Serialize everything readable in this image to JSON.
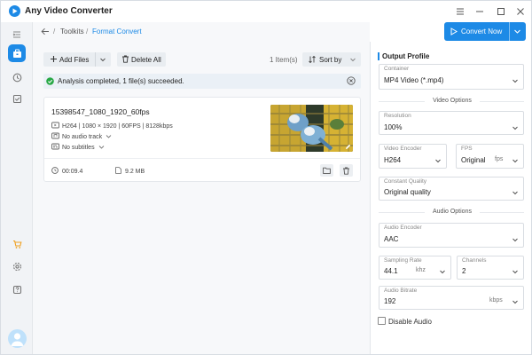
{
  "app": {
    "title": "Any Video Converter"
  },
  "breadcrumb": {
    "toolkits": "Toolkits",
    "separator": "/",
    "current": "Format Convert"
  },
  "toolbar": {
    "add_files": "Add Files",
    "delete_all": "Delete All",
    "item_count": "1 Item(s)",
    "sort_by": "Sort by",
    "convert_now": "Convert Now"
  },
  "banner": {
    "text": "Analysis completed, 1 file(s) succeeded."
  },
  "file": {
    "name": "15398547_1080_1920_60fps",
    "video_info": "H264 | 1080 × 1920 | 60FPS | 8128kbps",
    "audio": "No audio track",
    "subtitles": "No subtitles",
    "duration": "00:09.4",
    "size": "9.2 MB"
  },
  "output_profile": {
    "title": "Output Profile",
    "container": {
      "label": "Container",
      "value": "MP4 Video (*.mp4)"
    },
    "video_section": "Video Options",
    "resolution": {
      "label": "Resolution",
      "value": "100%"
    },
    "video_encoder": {
      "label": "Video Encoder",
      "value": "H264"
    },
    "fps": {
      "label": "FPS",
      "value": "Original",
      "unit": "fps"
    },
    "quality": {
      "label": "Constant Quality",
      "value": "Original quality"
    },
    "audio_section": "Audio Options",
    "audio_encoder": {
      "label": "Audio Encoder",
      "value": "AAC"
    },
    "sampling_rate": {
      "label": "Sampling Rate",
      "value": "44.1",
      "unit": "khz"
    },
    "channels": {
      "label": "Channels",
      "value": "2"
    },
    "audio_bitrate": {
      "label": "Audio Bitrate",
      "value": "192",
      "unit": "kbps"
    },
    "disable_audio": "Disable Audio"
  },
  "colors": {
    "accent": "#1d8ae6",
    "success": "#27a845"
  }
}
